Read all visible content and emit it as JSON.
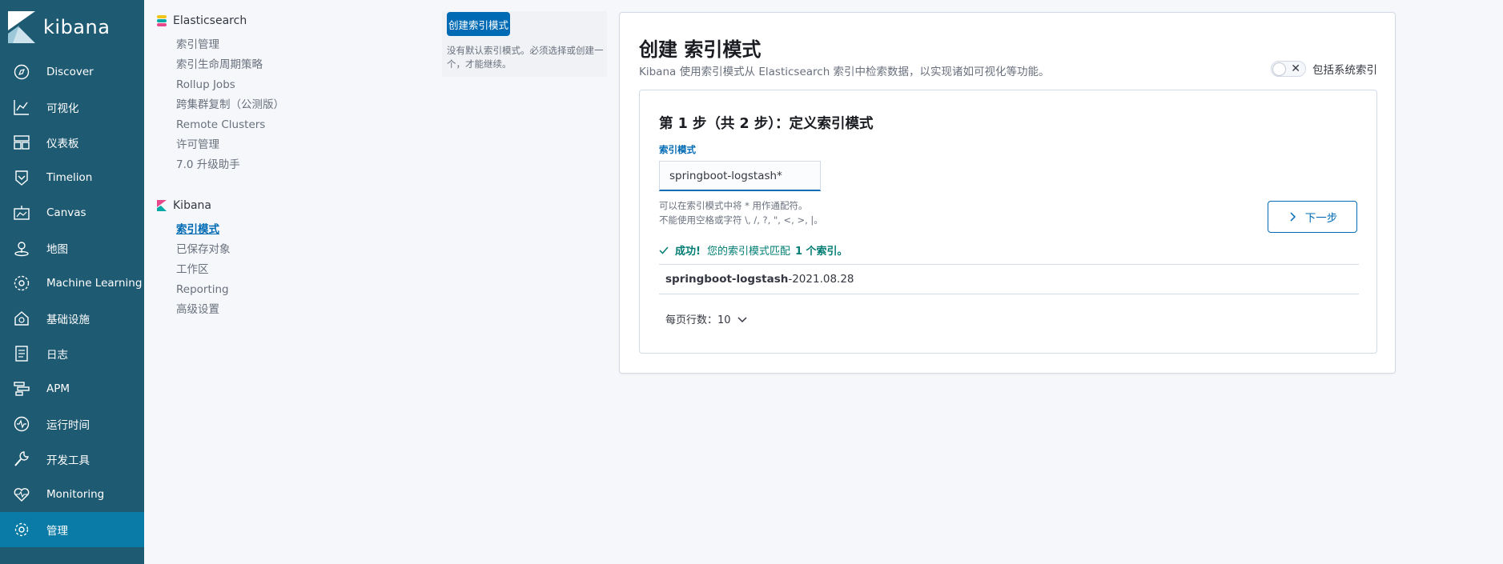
{
  "app": {
    "name": "kibana"
  },
  "nav": {
    "items": [
      {
        "label": "Discover",
        "icon": "compass-icon"
      },
      {
        "label": "可视化",
        "icon": "chart-icon"
      },
      {
        "label": "仪表板",
        "icon": "dashboard-icon"
      },
      {
        "label": "Timelion",
        "icon": "timelion-icon"
      },
      {
        "label": "Canvas",
        "icon": "canvas-icon"
      },
      {
        "label": "地图",
        "icon": "map-icon"
      },
      {
        "label": "Machine Learning",
        "icon": "ml-icon"
      },
      {
        "label": "基础设施",
        "icon": "infrastructure-icon"
      },
      {
        "label": "日志",
        "icon": "logs-icon"
      },
      {
        "label": "APM",
        "icon": "apm-icon"
      },
      {
        "label": "运行时间",
        "icon": "uptime-icon"
      },
      {
        "label": "开发工具",
        "icon": "wrench-icon"
      },
      {
        "label": "Monitoring",
        "icon": "heartbeat-icon"
      },
      {
        "label": "管理",
        "icon": "gear-icon"
      }
    ],
    "active": "管理"
  },
  "settings": {
    "elasticsearch": {
      "title": "Elasticsearch",
      "links": [
        "索引管理",
        "索引生命周期策略",
        "Rollup Jobs",
        "跨集群复制（公测版）",
        "Remote Clusters",
        "许可管理",
        "7.0 升级助手"
      ]
    },
    "kibana": {
      "title": "Kibana",
      "links": [
        "索引模式",
        "已保存对象",
        "工作区",
        "Reporting",
        "高级设置"
      ],
      "active": "索引模式"
    }
  },
  "callout": {
    "button": "创建索引模式",
    "text": "没有默认索引模式。必须选择或创建一个，才能继续。"
  },
  "main": {
    "title": "创建 索引模式",
    "subtitle": "Kibana 使用索引模式从 Elasticsearch 索引中检索数据，以实现诸如可视化等功能。",
    "toggle_label": "包括系统索引",
    "toggle_on": false,
    "step": {
      "title": "第 1 步（共 2 步）：定义索引模式",
      "field_label": "索引模式",
      "field_value": "springboot-logstash*",
      "help_line1": "可以在索引模式中将 * 用作通配符。",
      "help_line2": "不能使用空格或字符 \\, /, ?, \", <, >, |。",
      "next_button": "下一步",
      "success_prefix": "成功!",
      "success_text": "您的索引模式匹配",
      "success_count": "1 个索引。",
      "index_bold": "springboot-logstash",
      "index_rest": "-2021.08.28",
      "rows_per_page": "每页行数：10"
    }
  },
  "colors": {
    "nav_bg": "#1f5a73",
    "nav_active": "#0a7ba6",
    "primary": "#006bb4",
    "success": "#017d73"
  }
}
